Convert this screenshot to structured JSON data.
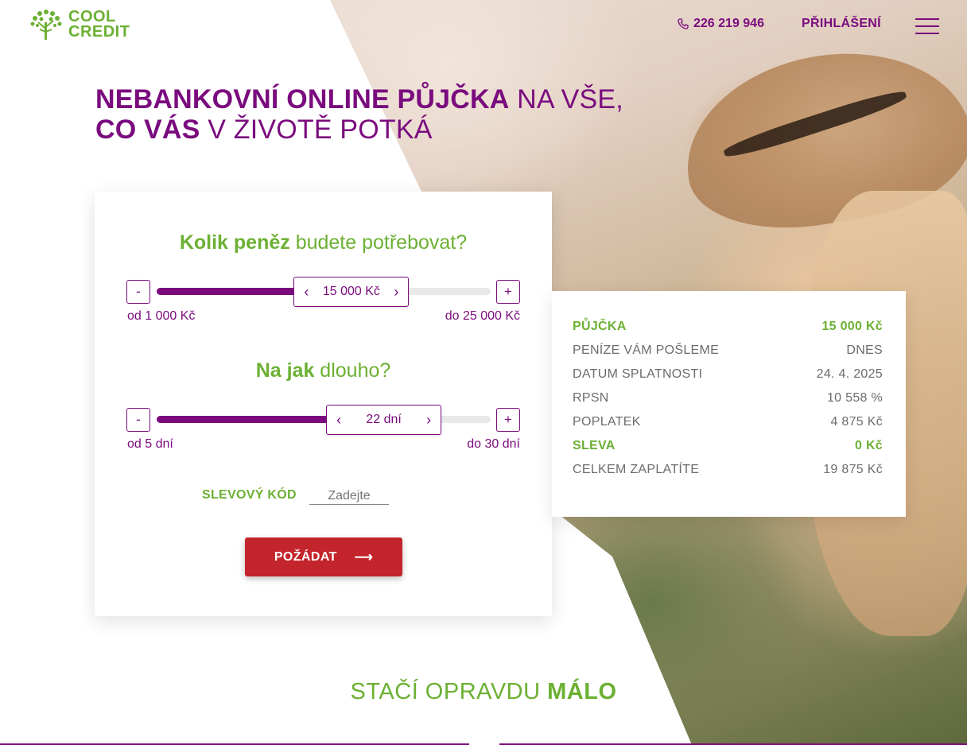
{
  "brand": {
    "line1": "COOL",
    "line2": "CREDIT",
    "green": "#6cb033",
    "purple": "#7a0b7e",
    "red": "#c4242b"
  },
  "header": {
    "phone": "226 219 946",
    "login": "PŘIHLÁŠENÍ",
    "menu_icon": "hamburger-menu-icon",
    "phone_icon": "phone-icon"
  },
  "hero": {
    "line1_bold": "NEBANKOVNÍ ONLINE PŮJČKA",
    "line1_light": " NA VŠE,",
    "line2_bold": "CO VÁS",
    "line2_light": " V ŽIVOTĚ POTKÁ"
  },
  "calculator": {
    "amount": {
      "question_bold": "Kolik peněz",
      "question_light": " budete potřebovat?",
      "minus": "-",
      "plus": "+",
      "value": "15 000 Kč",
      "min_label": "od 1 000 Kč",
      "max_label": "do 25 000 Kč",
      "fraction": 0.583
    },
    "duration": {
      "question_bold": "Na jak",
      "question_light": " dlouho?",
      "minus": "-",
      "plus": "+",
      "value": "22 dní",
      "min_label": "od 5 dní",
      "max_label": "do 30 dní",
      "fraction": 0.68
    },
    "promo": {
      "label": "SLEVOVÝ KÓD",
      "placeholder": "Zadejte"
    },
    "submit": {
      "label": "POŽÁDAT",
      "arrow": "⟶"
    }
  },
  "summary": {
    "rows": [
      {
        "label": "PŮJČKA",
        "value": "15 000 Kč"
      },
      {
        "label": "PENÍZE VÁM POŠLEME",
        "value": "DNES"
      },
      {
        "label": "DATUM SPLATNOSTI",
        "value": "24. 4. 2025"
      },
      {
        "label": "RPSN",
        "value": "10 558 %"
      },
      {
        "label": "POPLATEK",
        "value": "4 875 Kč"
      },
      {
        "label": "SLEVA",
        "value": "0 Kč"
      },
      {
        "label": "CELKEM ZAPLATÍTE",
        "value": "19 875 Kč"
      }
    ]
  },
  "bottom": {
    "title_light": "STAČÍ OPRAVDU ",
    "title_bold": "MÁLO"
  }
}
